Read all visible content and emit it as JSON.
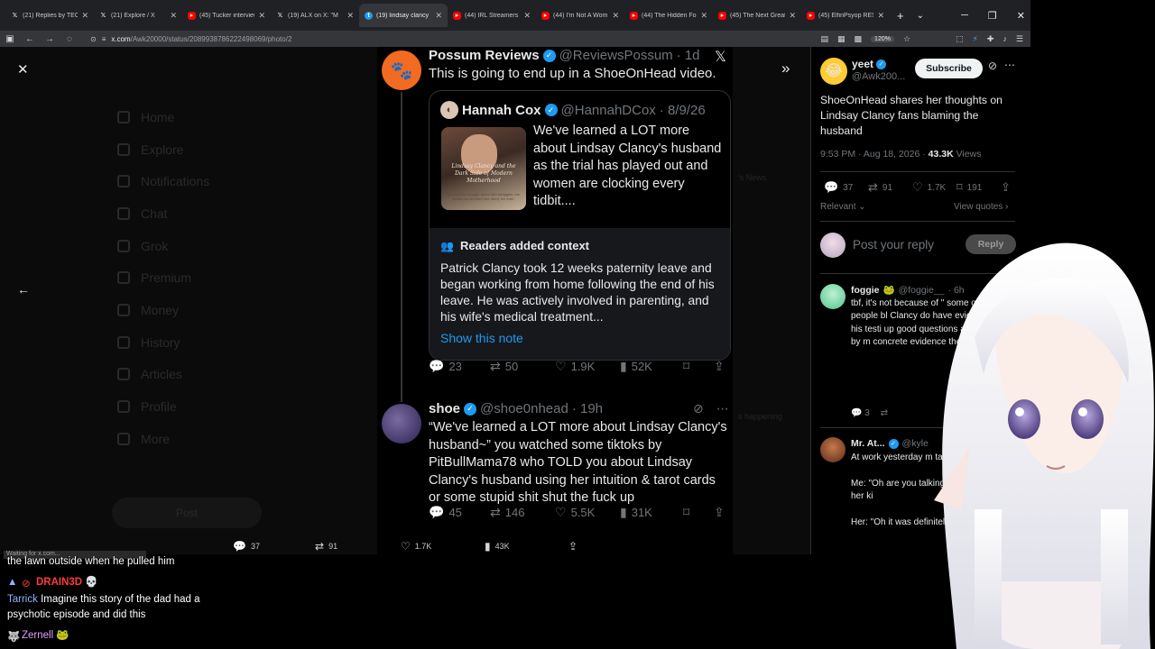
{
  "browser": {
    "tabs": [
      {
        "title": "(21) Replies by TECH",
        "icon": "x-icon",
        "active": false
      },
      {
        "title": "(21) Explore / X",
        "icon": "x-icon",
        "active": false
      },
      {
        "title": "(45) Tucker interview",
        "icon": "youtube-icon",
        "active": false
      },
      {
        "title": "(19) ALX on X: \"M",
        "icon": "x-icon",
        "active": false
      },
      {
        "title": "(19) lindsay clancy",
        "icon": "twitter-icon",
        "active": true
      },
      {
        "title": "(44) IRL Streamers A",
        "icon": "youtube-icon",
        "active": false
      },
      {
        "title": "(44) I'm Not A Wom",
        "icon": "youtube-icon",
        "active": false
      },
      {
        "title": "(44) The Hidden For",
        "icon": "youtube-icon",
        "active": false
      },
      {
        "title": "(45) The Next Great",
        "icon": "youtube-icon",
        "active": false
      },
      {
        "title": "(45) ElfinPsyop RESP",
        "icon": "youtube-icon",
        "active": false
      }
    ],
    "url_host": "x.com",
    "url_path": "/Awk20000/status/2089938786222498069/photo/2",
    "zoom": "120%"
  },
  "background_nav": [
    "Home",
    "Explore",
    "Notifications",
    "Chat",
    "Grok",
    "Premium",
    "Money",
    "History",
    "Articles",
    "Profile",
    "More"
  ],
  "background_post_button": "Post",
  "background_right": [
    "'s News",
    "s happening"
  ],
  "thread": {
    "post1": {
      "name": "Possum Reviews",
      "handle": "@ReviewsPossum",
      "time": "· 1d",
      "text": "This is going to end up in a ShoeOnHead video.",
      "quote": {
        "name": "Hannah Cox",
        "handle": "@HannahDCox",
        "time": "· 8/9/26",
        "text": "We've learned a LOT more about Lindsay Clancy's husband as the trial has played out and women are clocking every tidbit....",
        "thumb_title": "Lindsay Clancy and the Dark Side of Modern Motherhood",
        "thumb_subtitle": "As mothers struggle alone with struggles, the stories we tell them are rarely the truth."
      },
      "context": {
        "title": "Readers added context",
        "body": "Patrick Clancy took 12 weeks paternity leave and began working from home following the end of his leave. He was actively involved in parenting, and his wife's medical treatment...",
        "link": "Show this note"
      },
      "stats": {
        "replies": "23",
        "reposts": "50",
        "likes": "1.9K",
        "views": "52K"
      }
    },
    "post2": {
      "name": "shoe",
      "handle": "@shoe0nhead",
      "time": "· 19h",
      "text": "“We've learned a LOT more about Lindsay Clancy's husband~” you watched some tiktoks by PitBullMama78 who TOLD you about Lindsay Clancy's husband using her intuition & tarot cards or some stupid shit shut the fuck up",
      "stats": {
        "replies": "45",
        "reposts": "146",
        "likes": "5.5K",
        "views": "31K"
      }
    }
  },
  "bottom_bar": {
    "replies": "37",
    "reposts": "91",
    "likes": "1.7K",
    "views": "43K"
  },
  "status_tip": "Waiting for x.com...",
  "main_post": {
    "name": "yeet",
    "handle": "@Awk200...",
    "subscribe": "Subscribe",
    "text": "ShoeOnHead shares her thoughts on Lindsay Clancy fans blaming the husband",
    "time": "9:53 PM · Aug 18, 2026 · ",
    "views": "43.3K",
    "views_label": " Views",
    "stats": {
      "replies": "37",
      "reposts": "91",
      "likes": "1.7K",
      "bookmarks": "191"
    },
    "relevant": "Relevant",
    "view_quotes": "View quotes",
    "reply_placeholder": "Post your reply",
    "reply_button": "Reply"
  },
  "replies": [
    {
      "name": "foggie",
      "handle": "@foggie__",
      "time": "· 6h",
      "text": "tbf, it's not because of \" some of the people bl Clancy do have evide sections of his testi up good questions are debunked by m concrete evidence the trial especially",
      "replies": "3"
    },
    {
      "name": "Mr. At...",
      "handle": "@kyle",
      "text": "At work yesterday m talking about it.\n\nMe: \"Oh are you talking lady who killed all her ki\n\nHer: \"Oh it was definitely husband!\""
    }
  ],
  "chat": [
    {
      "user": "",
      "message": "the lawn outside when he pulled him"
    },
    {
      "user": "DRAIN3D",
      "message": ""
    },
    {
      "user": "Tarrick",
      "message": "Imagine this story of the dad had a"
    },
    {
      "user": "",
      "message": "psychotic episode and did this"
    },
    {
      "user": "Zernell",
      "message": ""
    }
  ],
  "colors": {
    "accent": "#1d9bf0",
    "text": "#e7e9ea",
    "muted": "#71767b",
    "brand_possum": "#f26b21"
  }
}
